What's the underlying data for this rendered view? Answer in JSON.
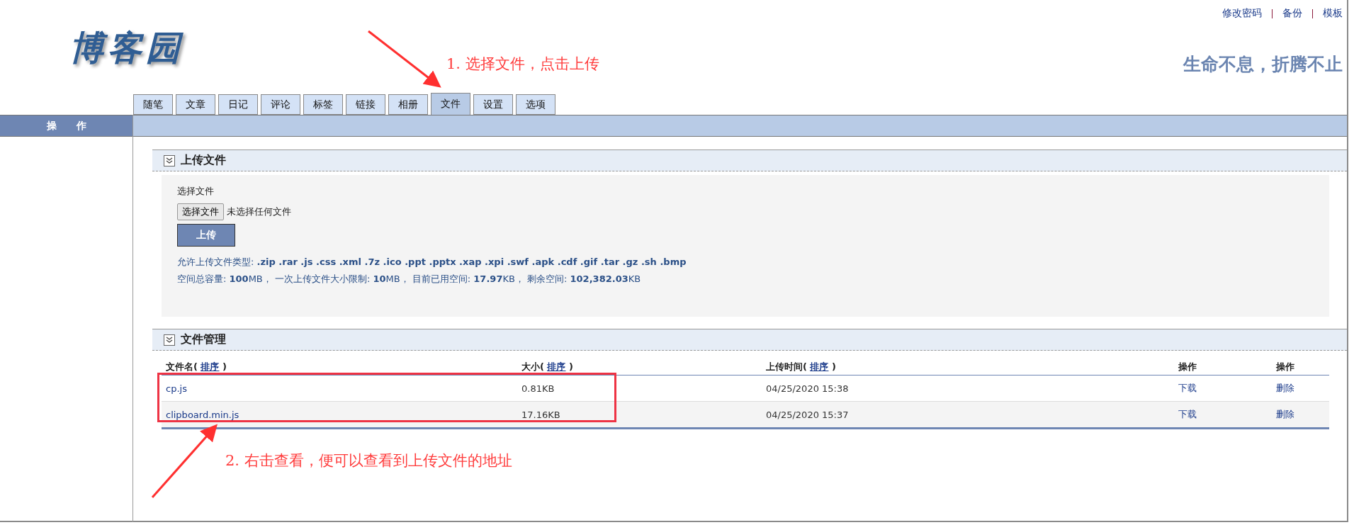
{
  "top_links": [
    "修改密码",
    "备份",
    "模板"
  ],
  "logo": "博客园",
  "tagline": "生命不息，折腾不止",
  "tabs": [
    {
      "label": "随笔",
      "selected": false
    },
    {
      "label": "文章",
      "selected": false
    },
    {
      "label": "日记",
      "selected": false
    },
    {
      "label": "评论",
      "selected": false
    },
    {
      "label": "标签",
      "selected": false
    },
    {
      "label": "链接",
      "selected": false
    },
    {
      "label": "相册",
      "selected": false
    },
    {
      "label": "文件",
      "selected": true
    },
    {
      "label": "设置",
      "selected": false
    },
    {
      "label": "选项",
      "selected": false
    }
  ],
  "sidebar": {
    "title": "操　　作"
  },
  "upload": {
    "title": "上传文件",
    "field_label": "选择文件",
    "choose_button": "选择文件",
    "no_file": "未选择任何文件",
    "submit": "上传",
    "info": [
      "允许上传文件类型: **.zip .rar .js .css .xml .7z .ico .ppt .pptx .xap .xpi .swf .apk .cdf .gif .tar .gz .sh .bmp**",
      "空间总容量: **100**MB， 一次上传文件大小限制: **10**MB， 目前已用空间: **17.97**KB， 剩余空间: **102,382.03**KB"
    ]
  },
  "files": {
    "title": "文件管理",
    "columns": [
      {
        "label": "文件名(",
        "sort": "排序",
        "close": ")"
      },
      {
        "label": "大小(",
        "sort": "排序",
        "close": ")"
      },
      {
        "label": "上传时间(",
        "sort": "排序",
        "close": ")"
      },
      {
        "label": "操作"
      },
      {
        "label": "操作"
      }
    ],
    "rows": [
      {
        "name": "cp.js",
        "size": "0.81KB",
        "time": "04/25/2020 15:38",
        "download": "下载",
        "delete": "删除"
      },
      {
        "name": "clipboard.min.js",
        "size": "17.16KB",
        "time": "04/25/2020 15:37",
        "download": "下载",
        "delete": "删除"
      }
    ]
  },
  "annotations": [
    {
      "kind": "arrow",
      "text": "1. 选择文件，点击上传"
    },
    {
      "kind": "arrow",
      "text": "2. 右击查看，便可以查看到上传文件的地址"
    }
  ]
}
